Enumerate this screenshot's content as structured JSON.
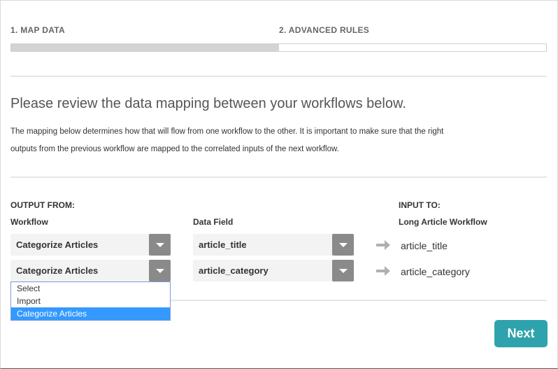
{
  "steps": [
    {
      "label": "1. MAP DATA"
    },
    {
      "label": "2. ADVANCED RULES"
    }
  ],
  "progress": {
    "fraction": 0.5
  },
  "heading": "Please review the data mapping between your workflows below.",
  "description_line1": "The mapping below determines how that will flow from one workflow to the other. It is important to make sure that the right",
  "description_line2": "outputs from the previous workflow are mapped to the correlated inputs of the next workflow.",
  "output_section": {
    "title": "OUTPUT FROM:",
    "workflow_label": "Workflow"
  },
  "data_field_label": "Data Field",
  "input_section": {
    "title": "INPUT TO:",
    "workflow_name": "Long Article Workflow"
  },
  "mappings": [
    {
      "workflow": "Categorize Articles",
      "field": "article_title",
      "input": "article_title"
    },
    {
      "workflow": "Categorize Articles",
      "field": "article_category",
      "input": "article_category"
    }
  ],
  "dropdown_options": [
    {
      "label": "Select",
      "selected": false
    },
    {
      "label": "Import",
      "selected": false
    },
    {
      "label": "Categorize Articles",
      "selected": true
    }
  ],
  "next_button": "Next",
  "colors": {
    "accent": "#2ea3ad",
    "select_highlight": "#3399ff",
    "progress_fill": "#d3d3d3"
  }
}
